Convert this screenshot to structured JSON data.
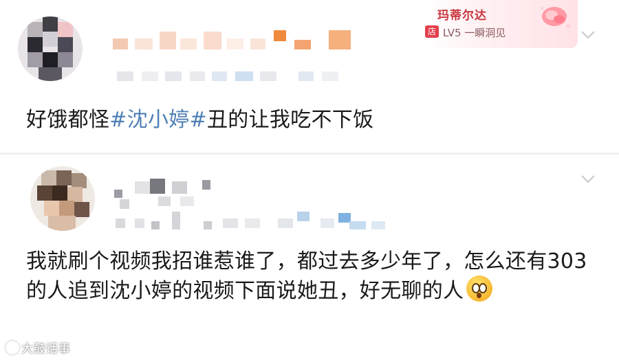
{
  "comments": [
    {
      "text_before": "好饿都怪",
      "hashtag": "#沈小婷#",
      "text_after": "丑的让我吃不下饭",
      "badge": {
        "name": "玛蒂尔达",
        "tag": "店",
        "level": "LV5 一瞬洞见"
      }
    },
    {
      "text": "我就刷个视频我招谁惹谁了，都过去多少年了，怎么还有303的人追到沈小婷的视频下面说她丑，好无聊的人"
    }
  ],
  "watermark": {
    "text": "大鼓话事"
  },
  "colors": {
    "hashtag": "#4e7fb5",
    "badge_name": "#c8363f"
  },
  "icons": {
    "more": "chevron-down-icon",
    "emoji": "flushed-face-icon"
  }
}
